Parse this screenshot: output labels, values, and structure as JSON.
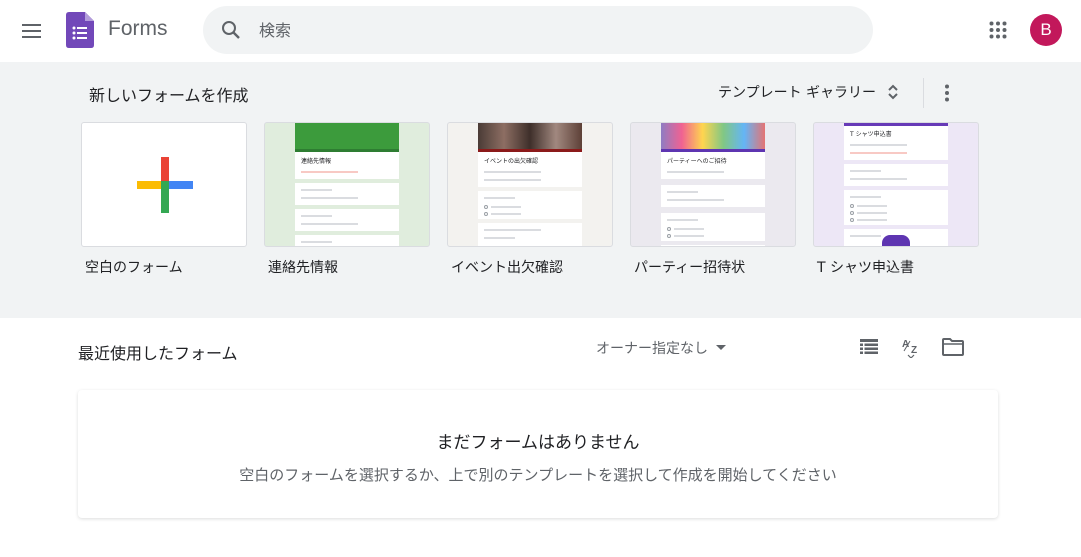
{
  "header": {
    "app_name": "Forms",
    "search_placeholder": "検索",
    "avatar_initial": "B",
    "avatar_color": "#c2185b"
  },
  "templates": {
    "title": "新しいフォームを作成",
    "gallery_label": "テンプレート ギャラリー",
    "items": [
      {
        "label": "空白のフォーム",
        "thumb": "blank"
      },
      {
        "label": "連絡先情報",
        "thumb": "contact",
        "thumb_title": "連絡先情報"
      },
      {
        "label": "イベント出欠確認",
        "thumb": "event",
        "thumb_title": "イベントの出欠確認"
      },
      {
        "label": "パーティー招待状",
        "thumb": "party",
        "thumb_title": "パーティーへのご招待"
      },
      {
        "label": "T シャツ申込書",
        "thumb": "tshirt",
        "thumb_title": "T シャツ申込書"
      }
    ]
  },
  "recent": {
    "title": "最近使用したフォーム",
    "owner_filter": "オーナー指定なし",
    "empty_title": "まだフォームはありません",
    "empty_desc": "空白のフォームを選択するか、上で別のテンプレートを選択して作成を開始してください"
  },
  "icons": {
    "menu": "menu-icon",
    "logo": "forms-logo-icon",
    "search": "search-icon",
    "apps": "apps-grid-icon",
    "gallery_sort": "unfold-icon",
    "more": "more-vert-icon",
    "owner_dropdown": "arrow-drop-down-icon",
    "list_view": "list-view-icon",
    "sort": "sort-az-icon",
    "folder": "folder-icon"
  },
  "colors": {
    "template_bg": "#f1f3f4",
    "forms_purple": "#673ab7"
  }
}
